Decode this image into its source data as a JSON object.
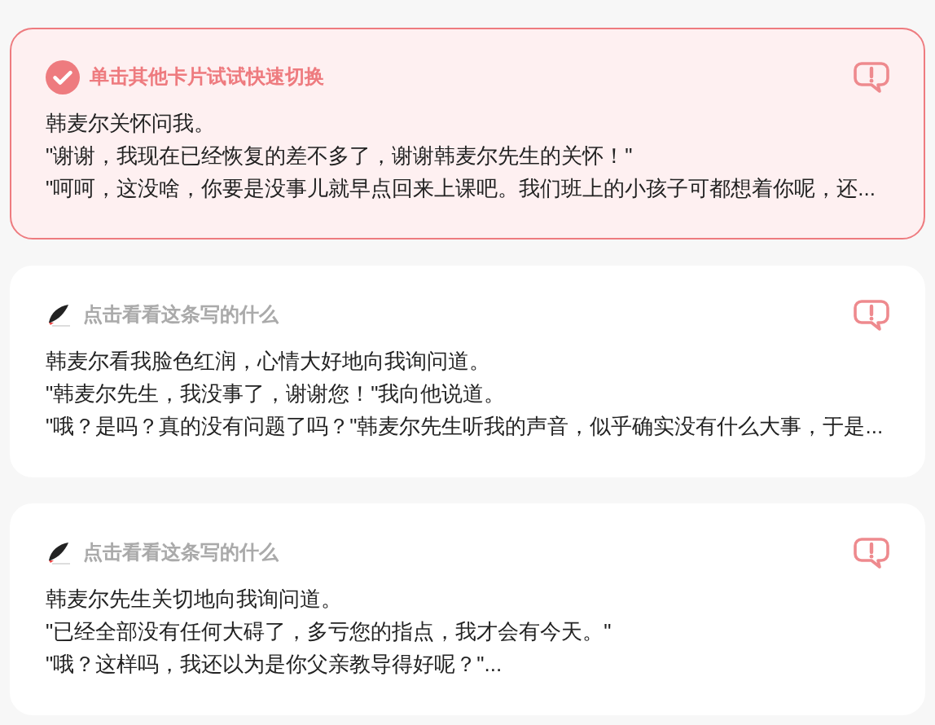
{
  "cards": [
    {
      "selected": true,
      "header": "单击其他卡片试试快速切换",
      "lines": [
        "韩麦尔关怀问我。",
        "\"谢谢，我现在已经恢复的差不多了，谢谢韩麦尔先生的关怀！\"",
        "\"呵呵，这没啥，你要是没事儿就早点回来上课吧。我们班上的小孩子可都想着你呢，还..."
      ]
    },
    {
      "selected": false,
      "header": "点击看看这条写的什么",
      "lines": [
        "韩麦尔看我脸色红润，心情大好地向我询问道。",
        "\"韩麦尔先生，我没事了，谢谢您！\"我向他说道。",
        "\"哦？是吗？真的没有问题了吗？\"韩麦尔先生听我的声音，似乎确实没有什么大事，于是..."
      ]
    },
    {
      "selected": false,
      "header": "点击看看这条写的什么",
      "lines": [
        "韩麦尔先生关切地向我询问道。",
        "\"已经全部没有任何大碍了，多亏您的指点，我才会有今天。\"",
        "\"哦？这样吗，我还以为是你父亲教导得好呢？\"..."
      ]
    }
  ]
}
